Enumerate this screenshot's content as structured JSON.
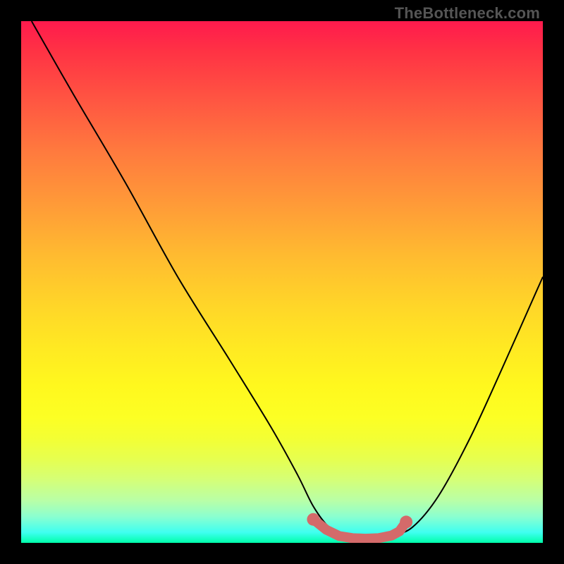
{
  "watermark": "TheBottleneck.com",
  "colors": {
    "curve_stroke": "#000000",
    "marker_stroke": "#d46a6a",
    "background_black": "#000000"
  },
  "chart_data": {
    "type": "line",
    "title": "",
    "xlabel": "",
    "ylabel": "",
    "xlim": [
      0,
      100
    ],
    "ylim": [
      0,
      100
    ],
    "grid": false,
    "legend": false,
    "series": [
      {
        "name": "bottleneck-curve",
        "x": [
          2,
          10,
          20,
          30,
          40,
          48,
          53,
          56,
          59,
          62,
          65,
          68,
          71,
          75,
          80,
          86,
          92,
          100
        ],
        "y": [
          100,
          86,
          69,
          51,
          35,
          22,
          13,
          7,
          3,
          1.2,
          0.8,
          0.8,
          1.4,
          3,
          9,
          20,
          33,
          51
        ]
      }
    ],
    "markers": {
      "name": "highlight-band",
      "x": [
        56,
        58.5,
        61,
        63.5,
        66,
        68.5,
        71,
        72.5,
        73.8
      ],
      "y": [
        4.5,
        2.5,
        1.3,
        0.9,
        0.8,
        0.9,
        1.4,
        2.2,
        4.0
      ]
    }
  }
}
